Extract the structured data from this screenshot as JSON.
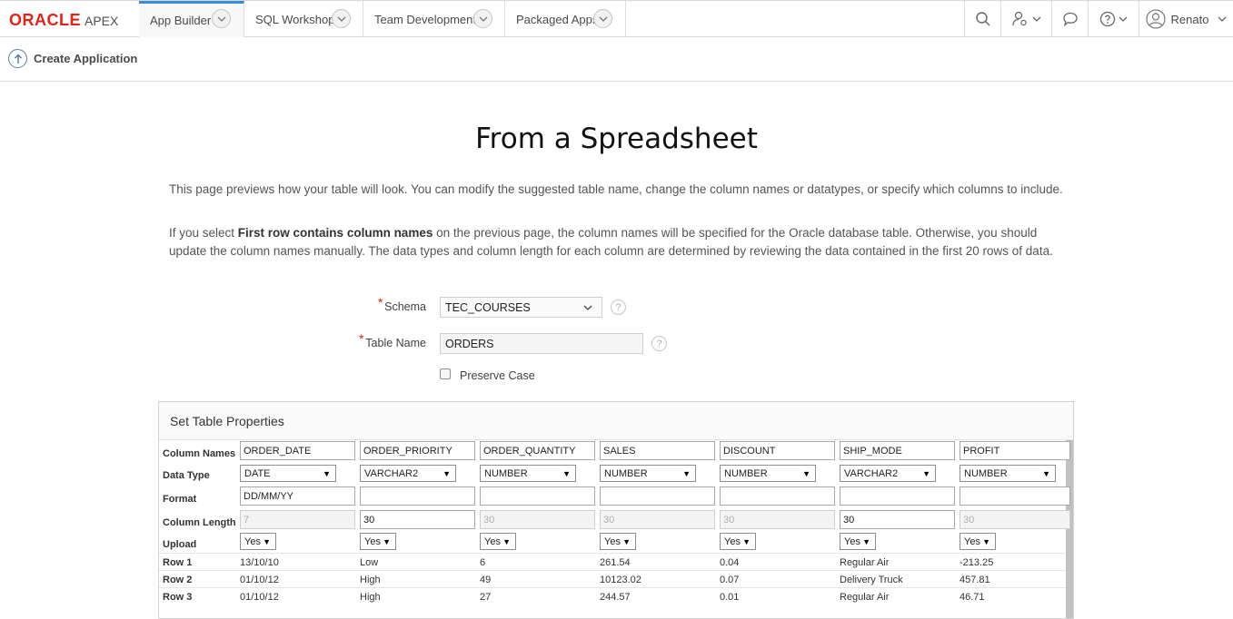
{
  "nav": {
    "logo_oracle": "ORACLE",
    "logo_apex": "APEX",
    "tabs": [
      {
        "label": "App Builder"
      },
      {
        "label": "SQL Workshop"
      },
      {
        "label": "Team Development"
      },
      {
        "label": "Packaged Apps"
      }
    ],
    "user": "Renato"
  },
  "subbar": {
    "create_label": "Create Application"
  },
  "main": {
    "title": "From a Spreadsheet",
    "para1": "This page previews how your table will look. You can modify the suggested table name, change the column names or datatypes, or specify which columns to include.",
    "para2_before": "If you select ",
    "para2_bold": "First row contains column names",
    "para2_after": " on the previous page, the column names will be specified for the Oracle database table. Otherwise, you should update the column names manually. The data types and column length for each column are determined by reviewing the data contained in the first 20 rows of data.",
    "schema_label": "Schema",
    "schema_value": "TEC_COURSES",
    "table_name_label": "Table Name",
    "table_name_value": "ORDERS",
    "preserve_case_label": "Preserve Case",
    "required_mark": "*",
    "help_glyph": "?"
  },
  "region": {
    "title": "Set Table Properties",
    "row_labels": {
      "names": "Column Names",
      "type": "Data Type",
      "format": "Format",
      "length": "Column Length",
      "upload": "Upload"
    },
    "columns": [
      {
        "name": "ORDER_DATE",
        "type": "DATE",
        "format": "DD/MM/YY",
        "length": "7",
        "upload": "Yes",
        "rows": [
          "13/10/10",
          "01/10/12",
          "01/10/12"
        ]
      },
      {
        "name": "ORDER_PRIORITY",
        "type": "VARCHAR2",
        "format": "",
        "length": "30",
        "upload": "Yes",
        "rows": [
          "Low",
          "High",
          "High"
        ]
      },
      {
        "name": "ORDER_QUANTITY",
        "type": "NUMBER",
        "format": "",
        "length": "30",
        "upload": "Yes",
        "rows": [
          "6",
          "49",
          "27"
        ]
      },
      {
        "name": "SALES",
        "type": "NUMBER",
        "format": "",
        "length": "30",
        "upload": "Yes",
        "rows": [
          "261.54",
          "10123.02",
          "244.57"
        ]
      },
      {
        "name": "DISCOUNT",
        "type": "NUMBER",
        "format": "",
        "length": "30",
        "upload": "Yes",
        "rows": [
          "0.04",
          "0.07",
          "0.01"
        ]
      },
      {
        "name": "SHIP_MODE",
        "type": "VARCHAR2",
        "format": "",
        "length": "30",
        "upload": "Yes",
        "rows": [
          "Regular Air",
          "Delivery Truck",
          "Regular Air"
        ]
      },
      {
        "name": "PROFIT",
        "type": "NUMBER",
        "format": "",
        "length": "30",
        "upload": "Yes",
        "rows": [
          "-213.25",
          "457.81",
          "46.71"
        ]
      }
    ],
    "data_rows": [
      {
        "label": "Row 1"
      },
      {
        "label": "Row 2"
      },
      {
        "label": "Row 3"
      }
    ]
  }
}
